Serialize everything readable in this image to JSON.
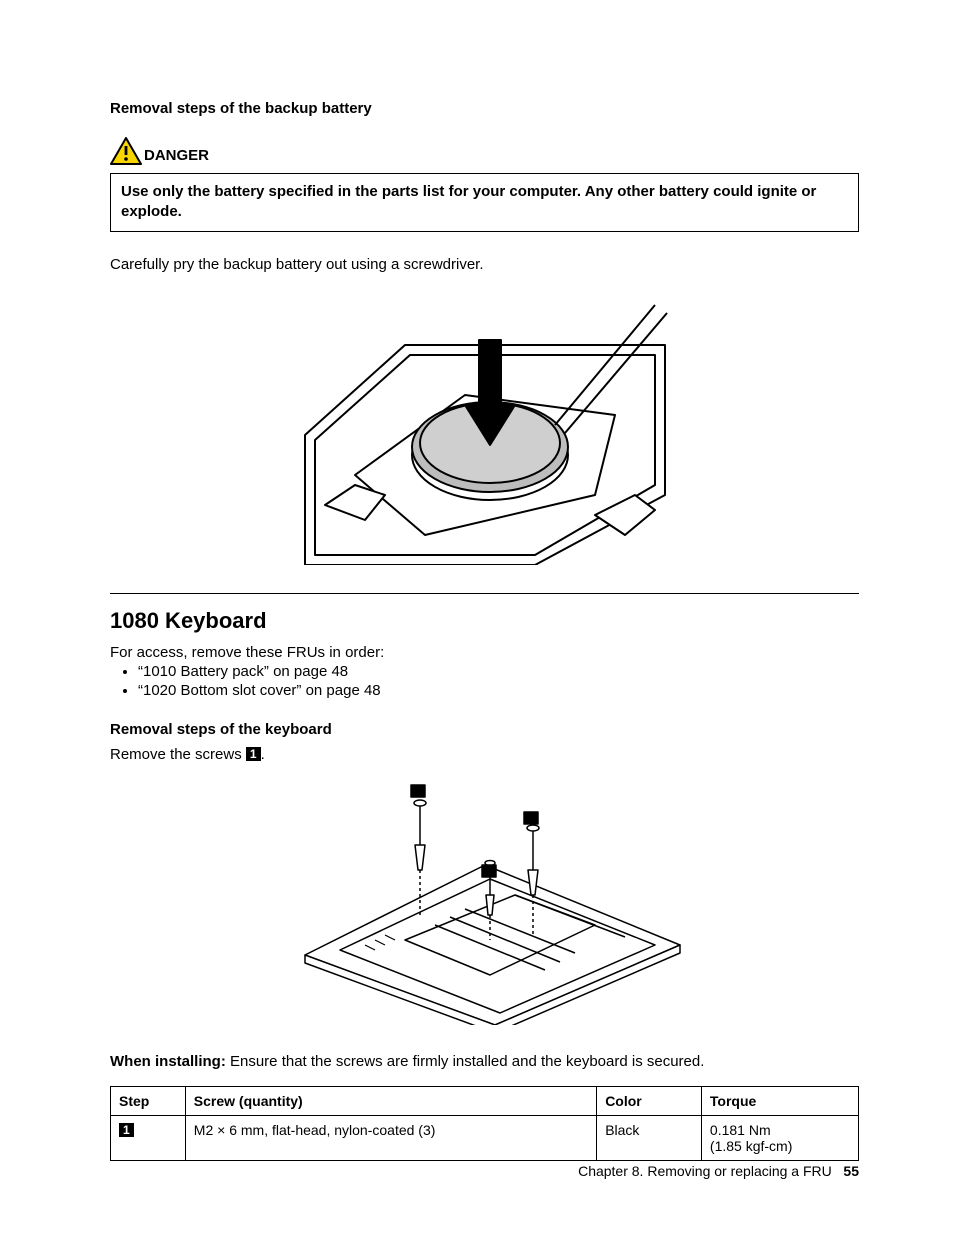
{
  "section1": {
    "title": "Removal steps of the backup battery",
    "danger_label": "DANGER",
    "danger_text": "Use only the battery specified in the parts list for your computer. Any other battery could ignite or explode.",
    "body": "Carefully pry the backup battery out using a screwdriver."
  },
  "section2": {
    "heading": "1080 Keyboard",
    "intro": "For access, remove these FRUs in order:",
    "frus": [
      "“1010 Battery pack” on page 48",
      "“1020 Bottom slot cover” on page 48"
    ],
    "sub_title": "Removal steps of the keyboard",
    "remove_prefix": "Remove the screws ",
    "step_badge": "1",
    "remove_suffix": ".",
    "install_label": "When installing:",
    "install_text": " Ensure that the screws are firmly installed and the keyboard is secured."
  },
  "table": {
    "headers": {
      "step": "Step",
      "screw": "Screw (quantity)",
      "color": "Color",
      "torque": "Torque"
    },
    "row": {
      "step_badge": "1",
      "screw": "M2 × 6 mm, flat-head, nylon-coated (3)",
      "color": "Black",
      "torque_line1": "0.181 Nm",
      "torque_line2": "(1.85 kgf-cm)"
    }
  },
  "footer": {
    "chapter": "Chapter 8. Removing or replacing a FRU",
    "page": "55"
  }
}
